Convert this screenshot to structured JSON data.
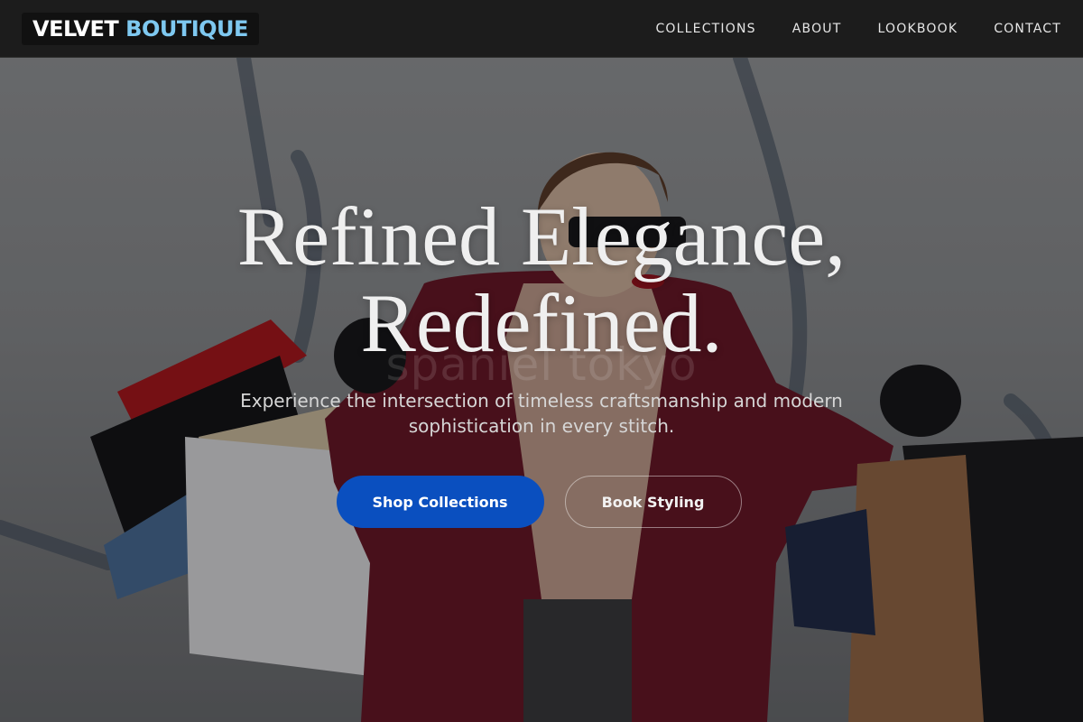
{
  "header": {
    "logo": {
      "word1": "VELVET",
      "word2": "BOUTIQUE"
    },
    "nav": [
      "COLLECTIONS",
      "ABOUT",
      "LOOKBOOK",
      "CONTACT"
    ]
  },
  "hero": {
    "title_line1": "Refined Elegance,",
    "title_line2": "Redefined.",
    "watermark": "spaniel tokyo",
    "subtitle_line1": "Experience the intersection of timeless craftsmanship and modern",
    "subtitle_line2": "sophistication in every stitch.",
    "primary_button": "Shop Collections",
    "secondary_button": "Book Styling"
  },
  "colors": {
    "logo_accent": "#7ec8f0",
    "primary_button": "#0a4fbf",
    "coat": "#6b1522"
  }
}
